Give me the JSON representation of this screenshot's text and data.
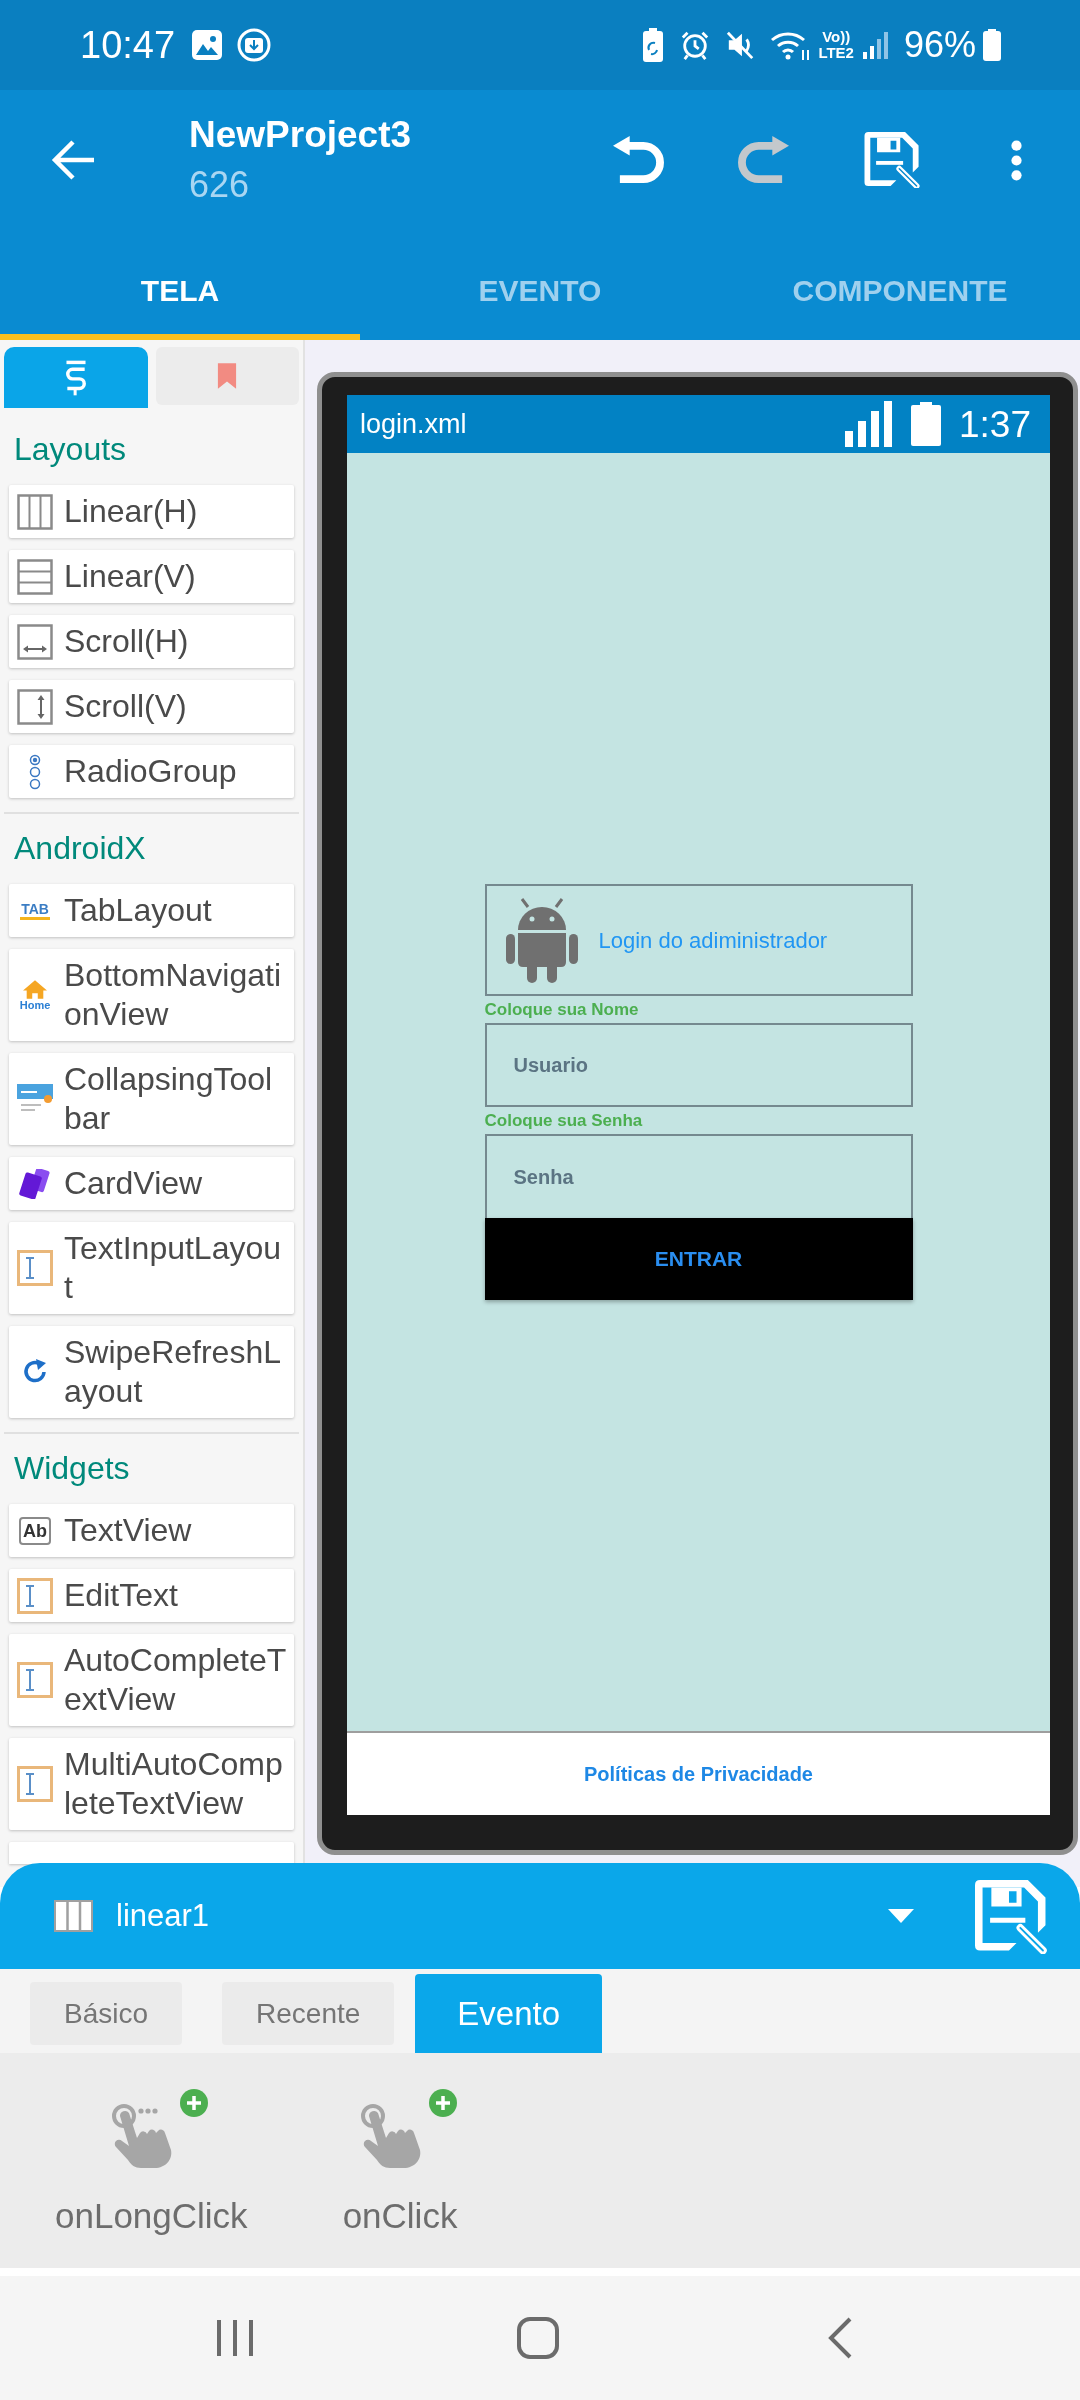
{
  "status_bar": {
    "time": "10:47",
    "volte": "Vo))",
    "network": "LTE2",
    "battery": "96%"
  },
  "app_bar": {
    "title": "NewProject3",
    "subtitle": "626",
    "actions": [
      {
        "kind": "undo",
        "disabled": false
      },
      {
        "kind": "redo",
        "disabled": true
      },
      {
        "kind": "save",
        "disabled": false
      },
      {
        "kind": "more",
        "disabled": false
      }
    ]
  },
  "tabs": [
    {
      "label": "TELA",
      "selected": true
    },
    {
      "label": "EVENTO",
      "selected": false
    },
    {
      "label": "COMPONENTE",
      "selected": false
    }
  ],
  "palette": {
    "tabs": [
      {
        "kind": "components",
        "selected": true
      },
      {
        "kind": "bookmarks",
        "selected": false
      }
    ],
    "sections": [
      {
        "title": "Layouts",
        "items": [
          {
            "kind": "columns",
            "label": "Linear(H)"
          },
          {
            "kind": "rows",
            "label": "Linear(V)"
          },
          {
            "kind": "hscroll",
            "label": "Scroll(H)"
          },
          {
            "kind": "vscroll",
            "label": "Scroll(V)"
          },
          {
            "kind": "radio",
            "label": "RadioGroup"
          }
        ]
      },
      {
        "title": "AndroidX",
        "items": [
          {
            "kind": "tabs",
            "icon_text": "TAB",
            "label": "TabLayout"
          },
          {
            "kind": "home",
            "icon_text": "Home",
            "label": "BottomNavigationView"
          },
          {
            "kind": "toolbar",
            "label": "CollapsingToolbar"
          },
          {
            "kind": "cards",
            "label": "CardView"
          },
          {
            "kind": "cursor",
            "label": "TextInputLayout"
          },
          {
            "kind": "refresh",
            "label": "SwipeRefreshLayout"
          }
        ]
      },
      {
        "title": "Widgets",
        "items": [
          {
            "kind": "text",
            "icon_text": "Ab",
            "label": "TextView"
          },
          {
            "kind": "cursor",
            "label": "EditText"
          },
          {
            "kind": "cursor",
            "label": "AutoCompleteTextView"
          },
          {
            "kind": "cursor",
            "label": "MultiAutoCompleteTextView"
          }
        ]
      }
    ]
  },
  "preview": {
    "file": "login.xml",
    "time": "1:37",
    "header": "Login do adiministrador",
    "fields": [
      {
        "label": "Coloque sua Nome",
        "placeholder": "Usuario"
      },
      {
        "label": "Coloque sua Senha",
        "placeholder": "Senha"
      }
    ],
    "button": "ENTRAR",
    "footer": "Políticas de Privacidade"
  },
  "properties": {
    "component": "linear1",
    "tabs": [
      {
        "label": "Básico",
        "selected": false
      },
      {
        "label": "Recente",
        "selected": false
      },
      {
        "label": "Evento",
        "selected": true
      }
    ],
    "events": [
      {
        "kind": "longclick",
        "label": "onLongClick"
      },
      {
        "kind": "click",
        "label": "onClick"
      }
    ]
  }
}
